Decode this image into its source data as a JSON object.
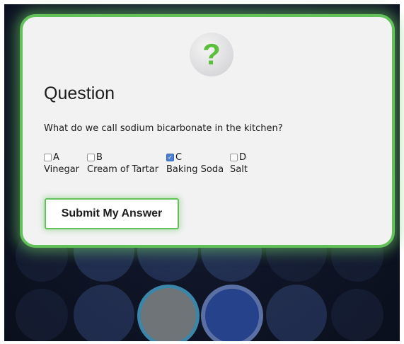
{
  "question_card": {
    "icon_glyph": "?",
    "heading": "Question",
    "prompt": "What do we call sodium bicarbonate in the kitchen?",
    "options": [
      {
        "letter": "A",
        "text": "Vinegar",
        "checked": false
      },
      {
        "letter": "B",
        "text": "Cream of Tartar",
        "checked": false
      },
      {
        "letter": "C",
        "text": "Baking Soda",
        "checked": true
      },
      {
        "letter": "D",
        "text": "Salt",
        "checked": false
      }
    ],
    "submit_label": "Submit My Answer"
  },
  "colors": {
    "accent_green": "#63c15a",
    "checkbox_checked": "#4a7fd3",
    "card_background": "#f2f2f3",
    "stage_background": "#0f1526"
  }
}
